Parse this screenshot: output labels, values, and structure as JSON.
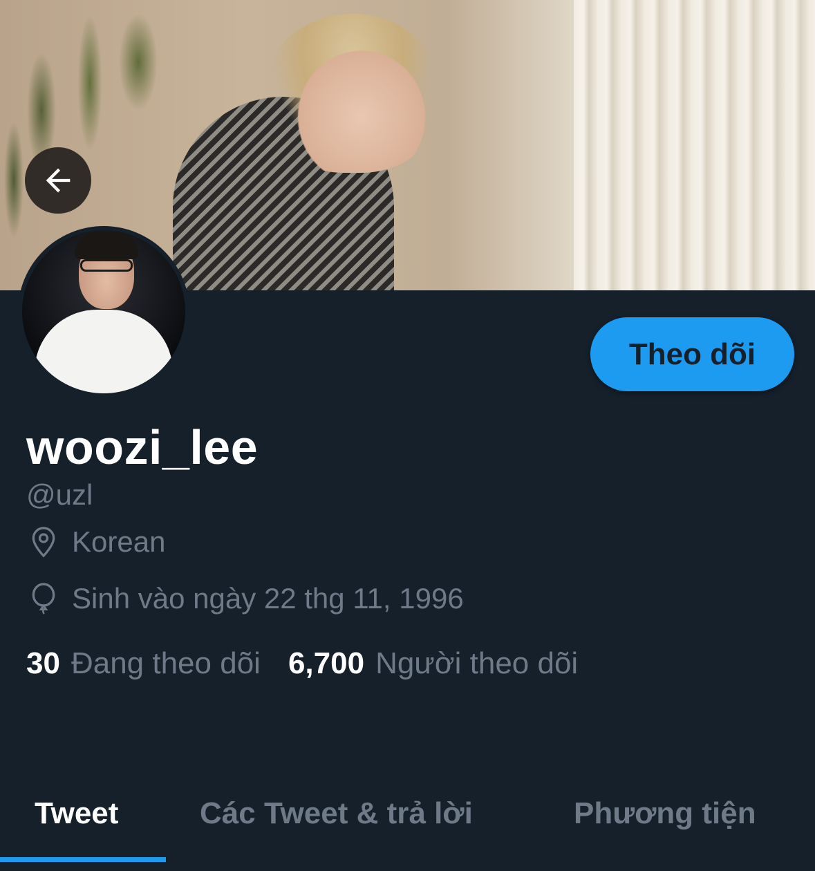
{
  "header": {
    "back_icon": "arrow-left-icon"
  },
  "profile": {
    "follow_label": "Theo dõi",
    "display_name": "woozi_lee",
    "handle": "@uzl",
    "location_icon": "location-pin-icon",
    "location": "Korean",
    "birthday_icon": "balloon-icon",
    "birthday": "Sinh vào ngày 22 thg 11, 1996",
    "following_count": "30",
    "following_label": "Đang theo dõi",
    "followers_count": "6,700",
    "followers_label": "Người theo dõi"
  },
  "tabs": [
    {
      "label": "Tweet",
      "active": true
    },
    {
      "label": "Các Tweet & trả lời",
      "active": false
    },
    {
      "label": "Phương tiện",
      "active": false
    }
  ],
  "colors": {
    "background": "#15202b",
    "accent": "#1d9bf0",
    "secondary_text": "#6e7a87"
  }
}
